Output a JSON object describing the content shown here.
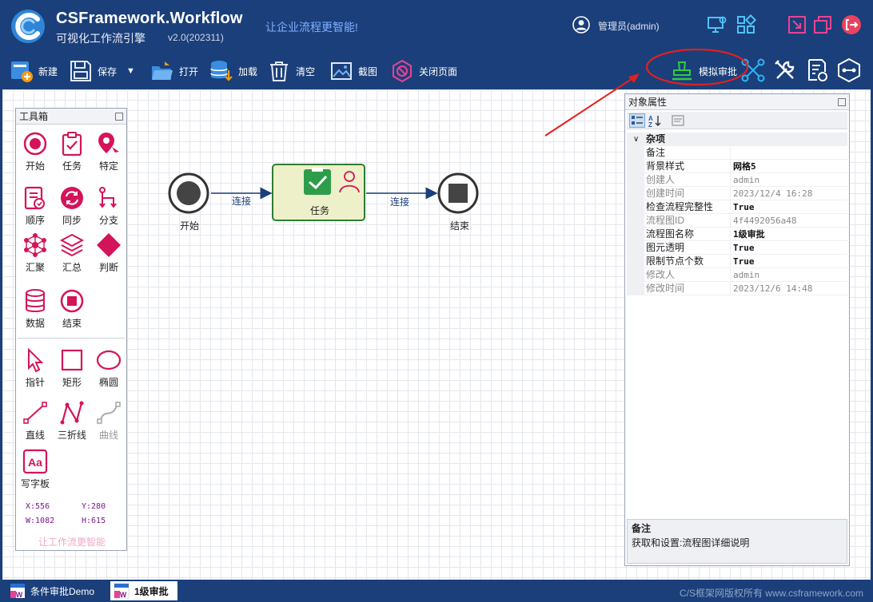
{
  "header": {
    "title": "CSFramework.Workflow",
    "subtitle": "可视化工作流引擎",
    "version": "v2.0(202311)",
    "slogan": "让企业流程更智能!",
    "user": "管理员(admin)"
  },
  "toolbar": {
    "new": "新建",
    "save": "保存",
    "open": "打开",
    "load": "加载",
    "clear": "清空",
    "screenshot": "截图",
    "close_page": "关闭页面",
    "simulate": "模拟审批"
  },
  "toolbox": {
    "title": "工具箱",
    "tools": [
      {
        "label": "开始"
      },
      {
        "label": "任务"
      },
      {
        "label": "特定"
      },
      {
        "label": "顺序"
      },
      {
        "label": "同步"
      },
      {
        "label": "分支"
      },
      {
        "label": "汇聚"
      },
      {
        "label": "汇总"
      },
      {
        "label": "判断"
      },
      {
        "label": "数据"
      },
      {
        "label": "结束"
      },
      {
        "label": "指针"
      },
      {
        "label": "矩形"
      },
      {
        "label": "椭圆"
      },
      {
        "label": "直线"
      },
      {
        "label": "三折线"
      },
      {
        "label": "曲线"
      },
      {
        "label": "写字板"
      }
    ],
    "coords": {
      "x": "X:556",
      "y": "Y:280",
      "w": "W:1082",
      "h": "H:615"
    },
    "footer": "让工作流更智能"
  },
  "diagram": {
    "start_label": "开始",
    "task_label": "任务",
    "end_label": "结束",
    "edge1_label": "连接",
    "edge2_label": "连接"
  },
  "properties": {
    "title": "对象属性",
    "category": "杂项",
    "rows": [
      {
        "name": "备注",
        "value": ""
      },
      {
        "name": "背景样式",
        "value": "网格5"
      },
      {
        "name": "创建人",
        "value": "admin"
      },
      {
        "name": "创建时间",
        "value": "2023/12/4 16:28"
      },
      {
        "name": "检查流程完整性",
        "value": "True"
      },
      {
        "name": "流程图ID",
        "value": "4f4492056a48"
      },
      {
        "name": "流程图名称",
        "value": "1级审批"
      },
      {
        "name": "图元透明",
        "value": "True"
      },
      {
        "name": "限制节点个数",
        "value": "True"
      },
      {
        "name": "修改人",
        "value": "admin"
      },
      {
        "name": "修改时间",
        "value": "2023/12/6 14:48"
      }
    ],
    "desc_title": "备注",
    "desc_text": "获取和设置:流程图详细说明"
  },
  "statusbar": {
    "tab1": "条件审批Demo",
    "tab2": "1级审批",
    "copyright": "C/S框架网版权所有 www.csframework.com"
  },
  "colors": {
    "header_bg": "#1b3f7a",
    "accent_pink": "#d4145a",
    "task_fill": "#eef0c9",
    "task_border": "#2e7d32",
    "annotation_red": "#e02020"
  }
}
